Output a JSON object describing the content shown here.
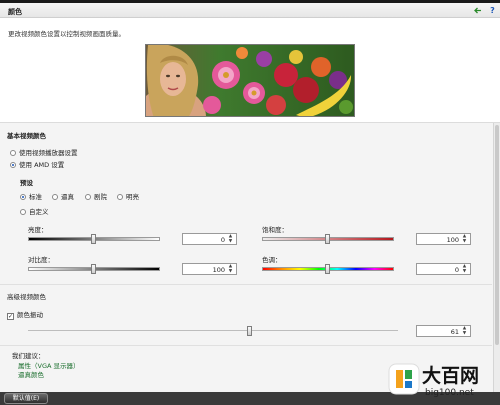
{
  "header": {
    "title": "颜色",
    "back_icon": "arrow-icon",
    "help_icon": "?"
  },
  "description": "更改视频颜色设置以控制视频画面质量。",
  "basic": {
    "title": "基本视频颜色",
    "options": [
      "使用视频播放器设置",
      "使用 AMD 设置"
    ],
    "preset_title": "预设",
    "presets": [
      "标准",
      "逼真",
      "剧院",
      "明亮"
    ],
    "custom": "自定义",
    "brightness": {
      "label": "亮度：",
      "value": "0",
      "level": 0.5
    },
    "contrast": {
      "label": "对比度：",
      "value": "100",
      "level": 0.5
    },
    "saturation": {
      "label": "饱和度：",
      "value": "100",
      "level": 0.5
    },
    "hue": {
      "label": "色调：",
      "value": "0",
      "level": 0.5
    }
  },
  "advanced": {
    "title": "高级视频颜色",
    "vibrance_label": "颜色振动",
    "vibrance_value": "61",
    "vibrance_level": 0.6
  },
  "recommend": {
    "title": "我们建议：",
    "links": [
      "属性（VGA 显示器）",
      "逼真颜色"
    ]
  },
  "footer": {
    "defaults_button": "默认值(E)"
  },
  "watermark": {
    "title": "大百网",
    "url": "big100.net"
  }
}
